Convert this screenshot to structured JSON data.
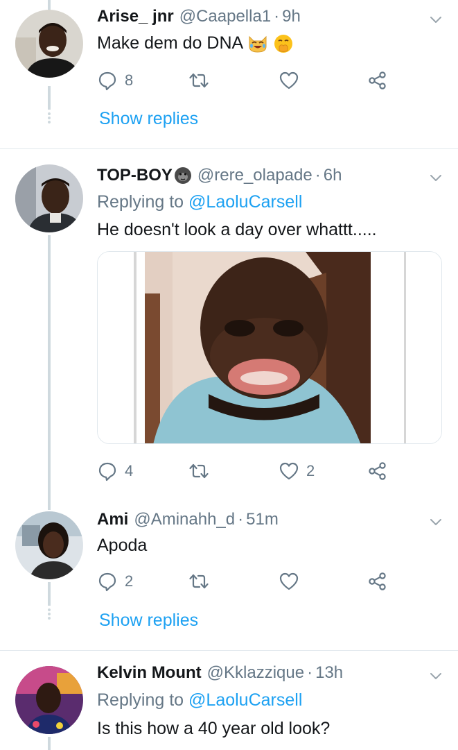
{
  "tweets": [
    {
      "name": "Arise_ jnr",
      "handle": "@Caapella1",
      "sep": "·",
      "time": "9h",
      "text": "Make dem do DNA",
      "replies": "8",
      "retweets": "",
      "likes": "",
      "show_replies": "Show replies"
    },
    {
      "name": "TOP-BOY",
      "handle": "@rere_olapade",
      "sep": "·",
      "time": "6h",
      "replying_label": "Replying to",
      "replying_to": "@LaoluCarsell",
      "text": "He doesn't look a day over whattt.....",
      "replies": "4",
      "retweets": "",
      "likes": "2"
    },
    {
      "name": "Ami",
      "handle": "@Aminahh_d",
      "sep": "·",
      "time": "51m",
      "text": "Apoda",
      "replies": "2",
      "retweets": "",
      "likes": "",
      "show_replies": "Show replies"
    },
    {
      "name": "Kelvin Mount",
      "handle": "@Kklazzique",
      "sep": "·",
      "time": "13h",
      "replying_label": "Replying to",
      "replying_to": "@LaoluCarsell",
      "text": "Is this how a 40 year old look?"
    }
  ],
  "colors": {
    "link": "#1da1f2",
    "secondary": "#657786",
    "primary": "#14171a",
    "line": "#cfd9de"
  },
  "icons": [
    "reply-icon",
    "retweet-icon",
    "like-icon",
    "share-icon",
    "chevron-down-icon",
    "gorilla-emoji",
    "cat-joy-emoji",
    "hand-over-mouth-emoji"
  ]
}
